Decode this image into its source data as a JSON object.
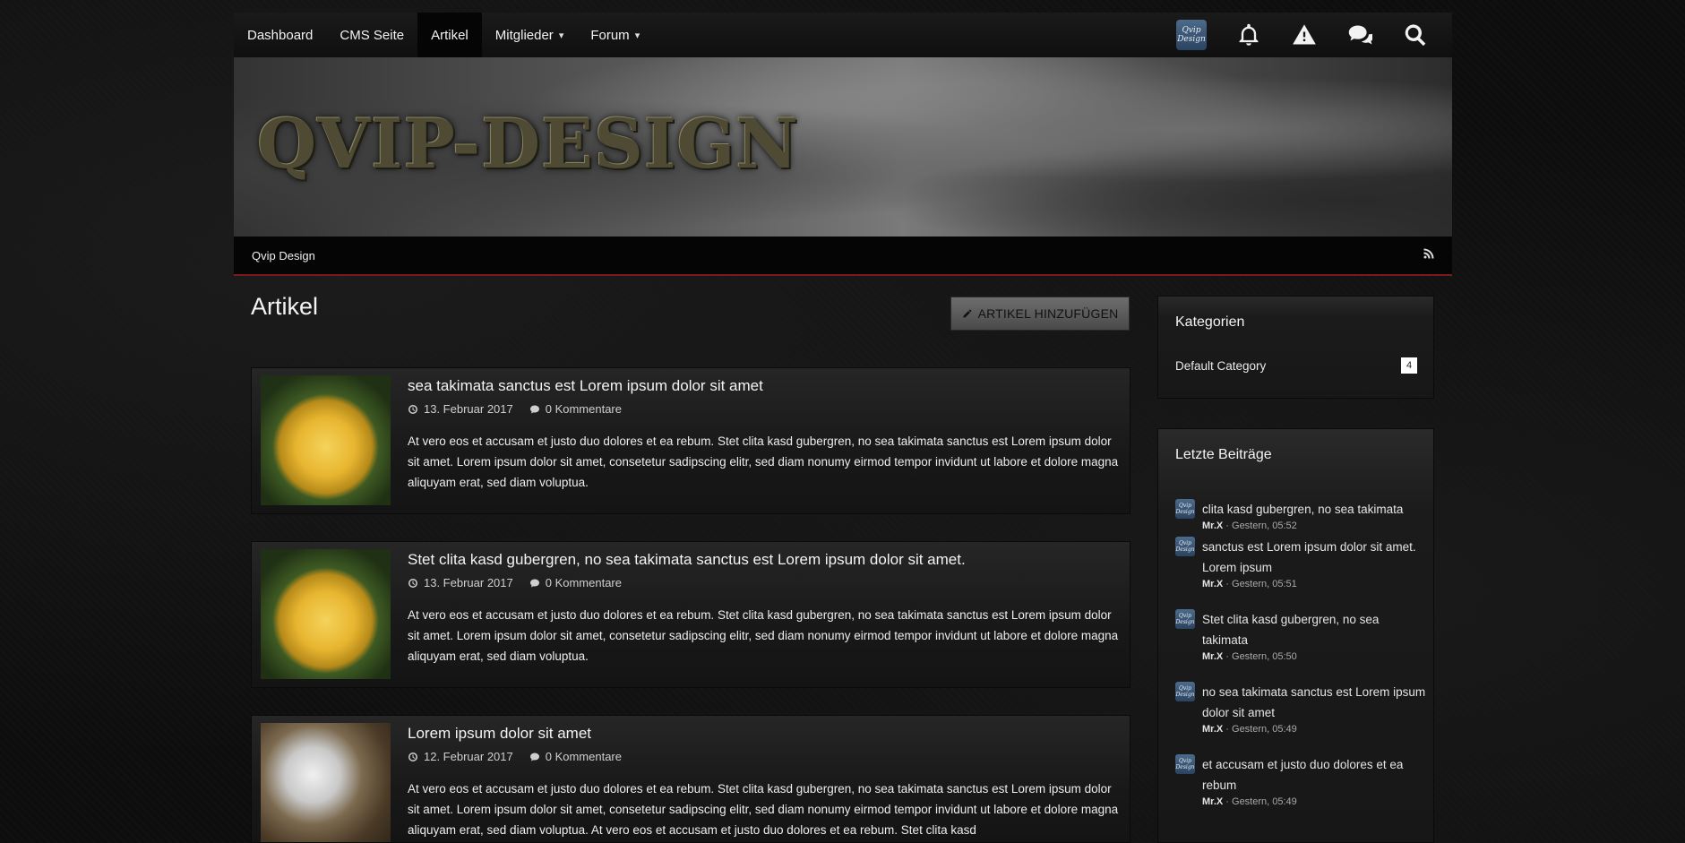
{
  "nav": {
    "items": [
      {
        "label": "Dashboard",
        "caret": ""
      },
      {
        "label": "CMS Seite",
        "caret": ""
      },
      {
        "label": "Artikel",
        "caret": ""
      },
      {
        "label": "Mitglieder",
        "caret": "⌄"
      },
      {
        "label": "Forum",
        "caret": "⌄"
      }
    ],
    "active": "Artikel",
    "logo_text": "Qvip Design"
  },
  "banner": {
    "title": "QVIP-DESIGN"
  },
  "breadcrumb": {
    "label": "Qvip Design"
  },
  "main": {
    "title": "Artikel",
    "add_button": "ARTIKEL HINZUFÜGEN",
    "articles": [
      {
        "title": "sea takimata sanctus est Lorem ipsum dolor sit amet",
        "date": "13. Februar 2017",
        "comments": "0 Kommentare",
        "text": "At vero eos et accusam et justo duo dolores et ea rebum. Stet clita kasd gubergren, no sea takimata sanctus est Lorem ipsum dolor sit amet. Lorem ipsum dolor sit amet, consetetur sadipscing elitr, sed diam nonumy eirmod tempor invidunt ut labore et dolore magna aliquyam erat, sed diam voluptua."
      },
      {
        "title": "Stet clita kasd gubergren, no sea takimata sanctus est Lorem ipsum dolor sit amet.",
        "date": "13. Februar 2017",
        "comments": "0 Kommentare",
        "text": "At vero eos et accusam et justo duo dolores et ea rebum. Stet clita kasd gubergren, no sea takimata sanctus est Lorem ipsum dolor sit amet. Lorem ipsum dolor sit amet, consetetur sadipscing elitr, sed diam nonumy eirmod tempor invidunt ut labore et dolore magna aliquyam erat, sed diam voluptua."
      },
      {
        "title": "Lorem ipsum dolor sit amet",
        "date": "12. Februar 2017",
        "comments": "0 Kommentare",
        "text": "At vero eos et accusam et justo duo dolores et ea rebum. Stet clita kasd gubergren, no sea takimata sanctus est Lorem ipsum dolor sit amet. Lorem ipsum dolor sit amet, consetetur sadipscing elitr, sed diam nonumy eirmod tempor invidunt ut labore et dolore magna aliquyam erat, sed diam voluptua. At vero eos et accusam et justo duo dolores et ea rebum. Stet clita kasd"
      }
    ]
  },
  "sidebar": {
    "categories": {
      "title": "Kategorien",
      "items": [
        {
          "name": "Default Category",
          "count": "4"
        }
      ]
    },
    "recent": {
      "title": "Letzte Beiträge",
      "posts": [
        {
          "title": "clita kasd gubergren, no sea takimata",
          "author": "Mr.X",
          "time": " · Gestern, 05:52"
        },
        {
          "title": "sanctus est Lorem ipsum dolor sit amet. Lorem ipsum",
          "author": "Mr.X",
          "time": " · Gestern, 05:51"
        },
        {
          "title": "Stet clita kasd gubergren, no sea takimata",
          "author": "Mr.X",
          "time": " · Gestern, 05:50"
        },
        {
          "title": "no sea takimata sanctus est Lorem ipsum dolor sit amet",
          "author": "Mr.X",
          "time": " · Gestern, 05:49"
        },
        {
          "title": "et accusam et justo duo dolores et ea rebum",
          "author": "Mr.X",
          "time": " · Gestern, 05:49"
        }
      ]
    }
  },
  "icons": [
    "bell-icon",
    "warning-icon",
    "comments-icon",
    "search-icon",
    "rss-icon",
    "pencil-icon",
    "clock-icon",
    "comment-icon"
  ],
  "colors": {
    "accent_line": "#7a1a1a",
    "background": "#0e0e0e"
  }
}
